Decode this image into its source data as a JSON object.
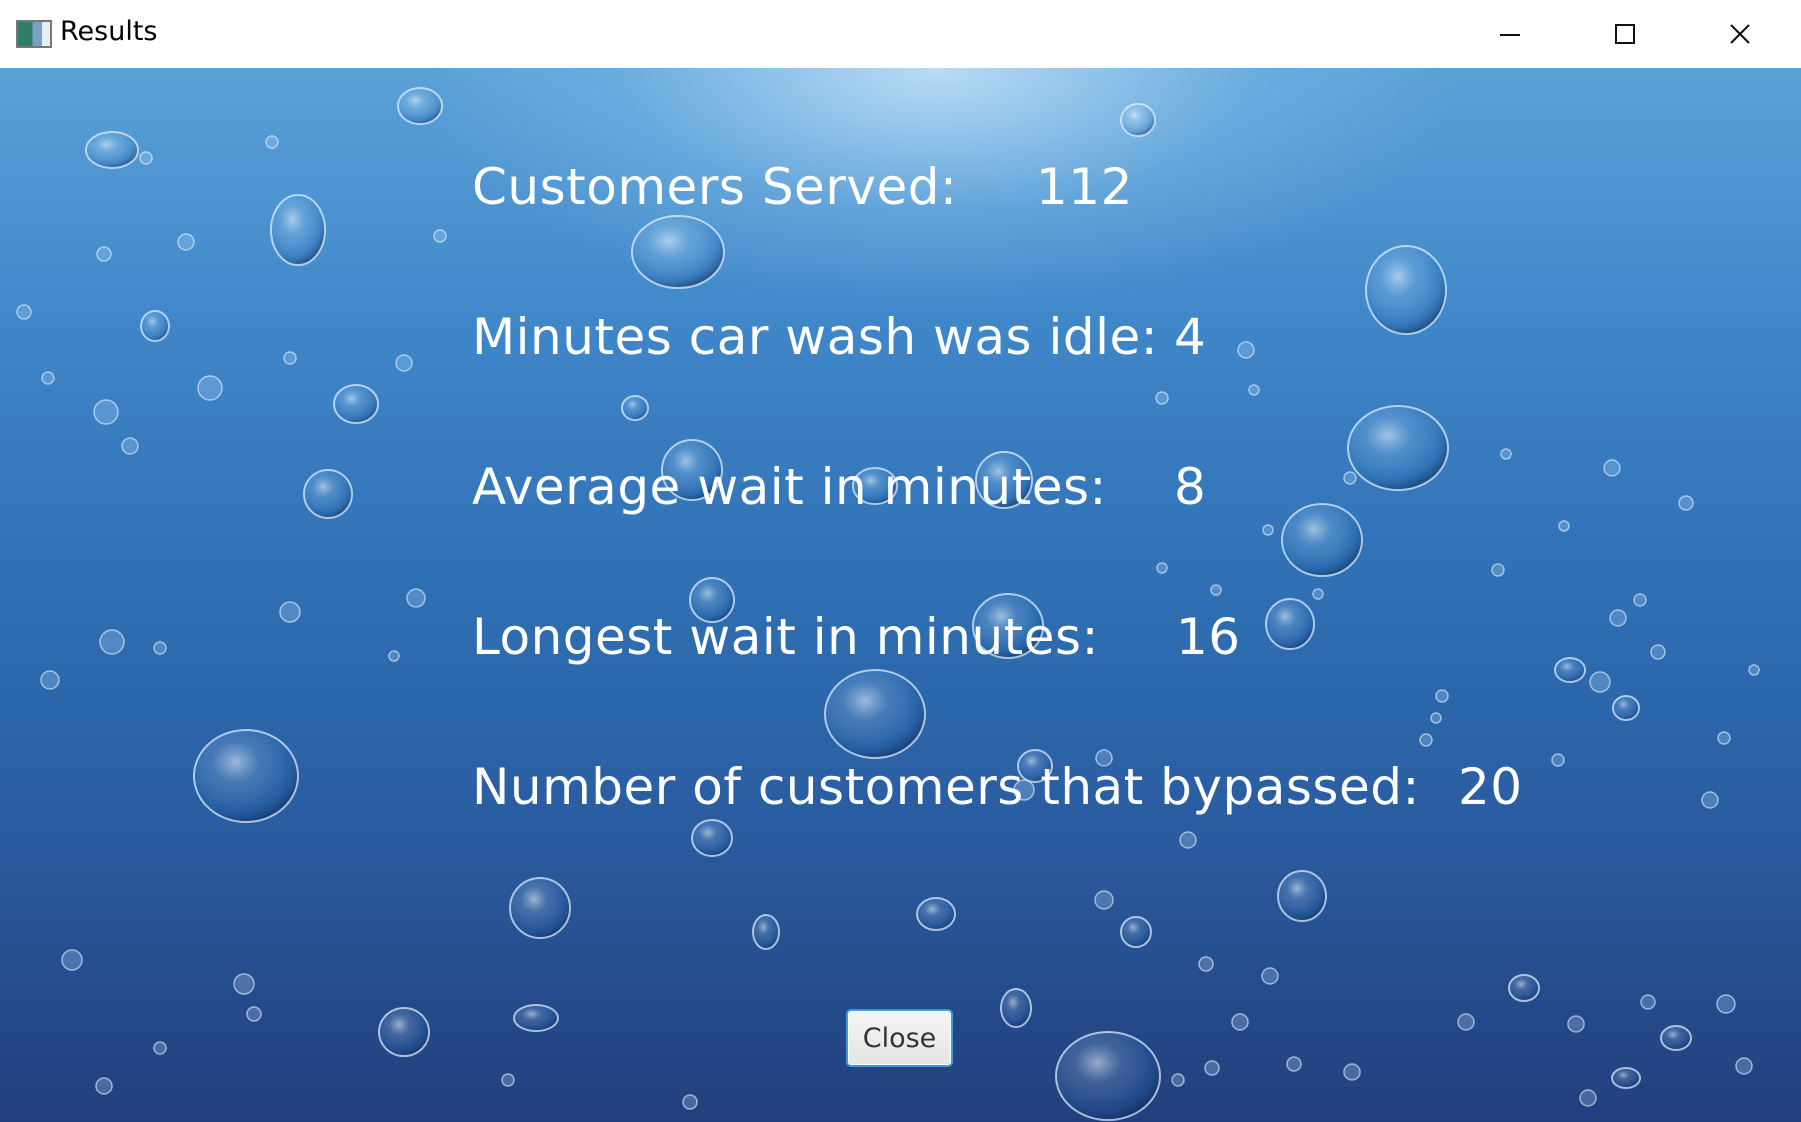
{
  "window": {
    "title": "Results",
    "icons": {
      "app": "app-window-icon",
      "minimize": "minimize-icon",
      "maximize": "maximize-icon",
      "close": "close-icon"
    }
  },
  "results": {
    "customers_served": {
      "label": "Customers Served:",
      "value": "112"
    },
    "idle_minutes": {
      "label": "Minutes car wash was idle:",
      "value": "4"
    },
    "average_wait": {
      "label": "Average wait in minutes:",
      "value": "8"
    },
    "longest_wait": {
      "label": "Longest wait in minutes:",
      "value": "16"
    },
    "bypassed": {
      "label": "Number of customers that bypassed:",
      "value": "20"
    }
  },
  "actions": {
    "close_label": "Close"
  },
  "colors": {
    "background_top": "#5aa1d8",
    "background_bottom": "#223f7c",
    "text": "#ffffff",
    "focus_border": "#3d9bd9"
  }
}
